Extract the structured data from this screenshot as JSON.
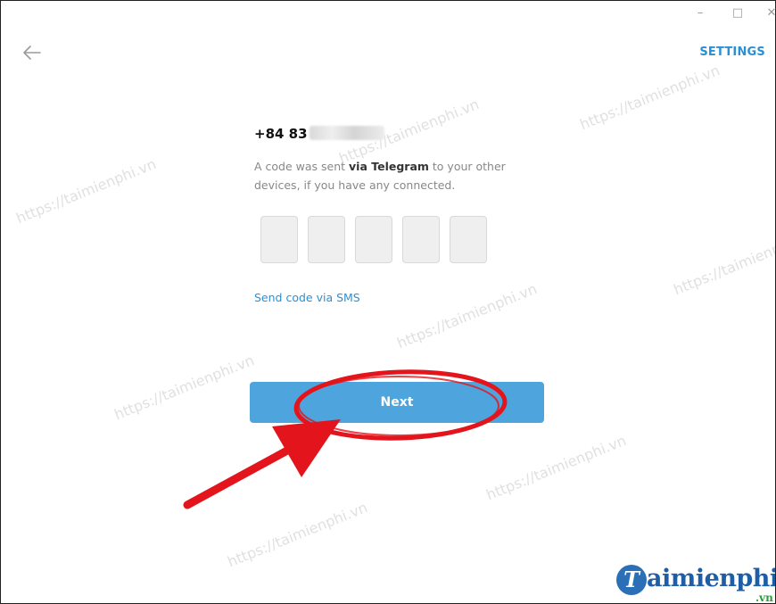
{
  "window": {
    "minimize_glyph": "–",
    "maximize_glyph": "□",
    "close_glyph": "✕"
  },
  "header": {
    "back_icon": "arrow-left-icon",
    "settings_label": "SETTINGS"
  },
  "main": {
    "phone_number_visible": "+84 83",
    "description_prefix": "A code was sent ",
    "description_emphasis": "via Telegram",
    "description_suffix": " to your other devices, if you have any connected.",
    "code_box_count": 5,
    "sms_link_label": "Send code via SMS",
    "next_button_label": "Next"
  },
  "watermark_text": "https://taimienphi.vn",
  "logo": {
    "mark": "T",
    "text": "aimienphi",
    "tld": ".vn"
  },
  "colors": {
    "accent": "#2b8fd4",
    "button": "#4ea4dd",
    "annotation_red": "#e3141b",
    "logo_blue": "#1e5ea6",
    "logo_green": "#2e9a3c"
  }
}
